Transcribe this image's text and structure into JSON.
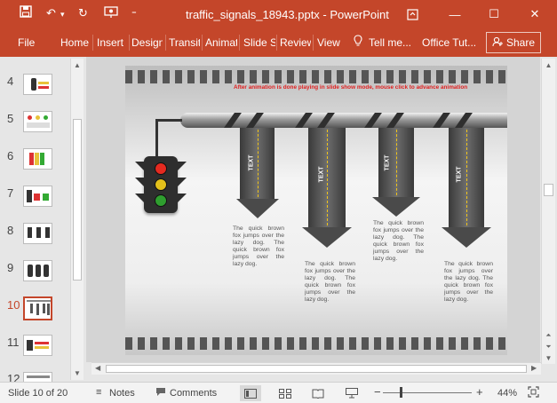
{
  "window": {
    "title": "traffic_signals_18943.pptx - PowerPoint",
    "save_icon": "save-icon",
    "undo_icon": "undo-icon",
    "redo_icon": "redo-icon",
    "present_icon": "present-from-beginning-icon",
    "customize_icon": "customize-toolbar-icon",
    "ribbon_display_icon": "ribbon-display-options-icon",
    "minimize": "—",
    "maximize": "☐",
    "close": "✕"
  },
  "ribbon": {
    "tabs": [
      "File",
      "Home",
      "Insert",
      "Design",
      "Transitions",
      "Animations",
      "Slide Show",
      "Review",
      "View"
    ],
    "tell_me": "Tell me...",
    "office_tut": "Office Tut...",
    "share": "Share"
  },
  "thumbnails": {
    "numbers": [
      "4",
      "5",
      "6",
      "7",
      "8",
      "9",
      "10",
      "11",
      "12"
    ],
    "active": "10"
  },
  "slide": {
    "note": "After animation is done playing in slide show mode, mouse click to advance animation",
    "arrow_labels": [
      "TEXT",
      "TEXT",
      "TEXT",
      "TEXT"
    ],
    "body_text": "The quick brown fox jumps over the lazy dog. The quick brown fox jumps over the lazy dog."
  },
  "status": {
    "slide_counter": "Slide 10 of 20",
    "notes": "Notes",
    "comments": "Comments",
    "zoom_minus": "−",
    "zoom_plus": "+",
    "zoom": "44%"
  },
  "colors": {
    "accent": "#c4462a",
    "active_thumb_border": "#c4462a",
    "note_text": "#e02020",
    "lane_dash": "#f0c419"
  }
}
